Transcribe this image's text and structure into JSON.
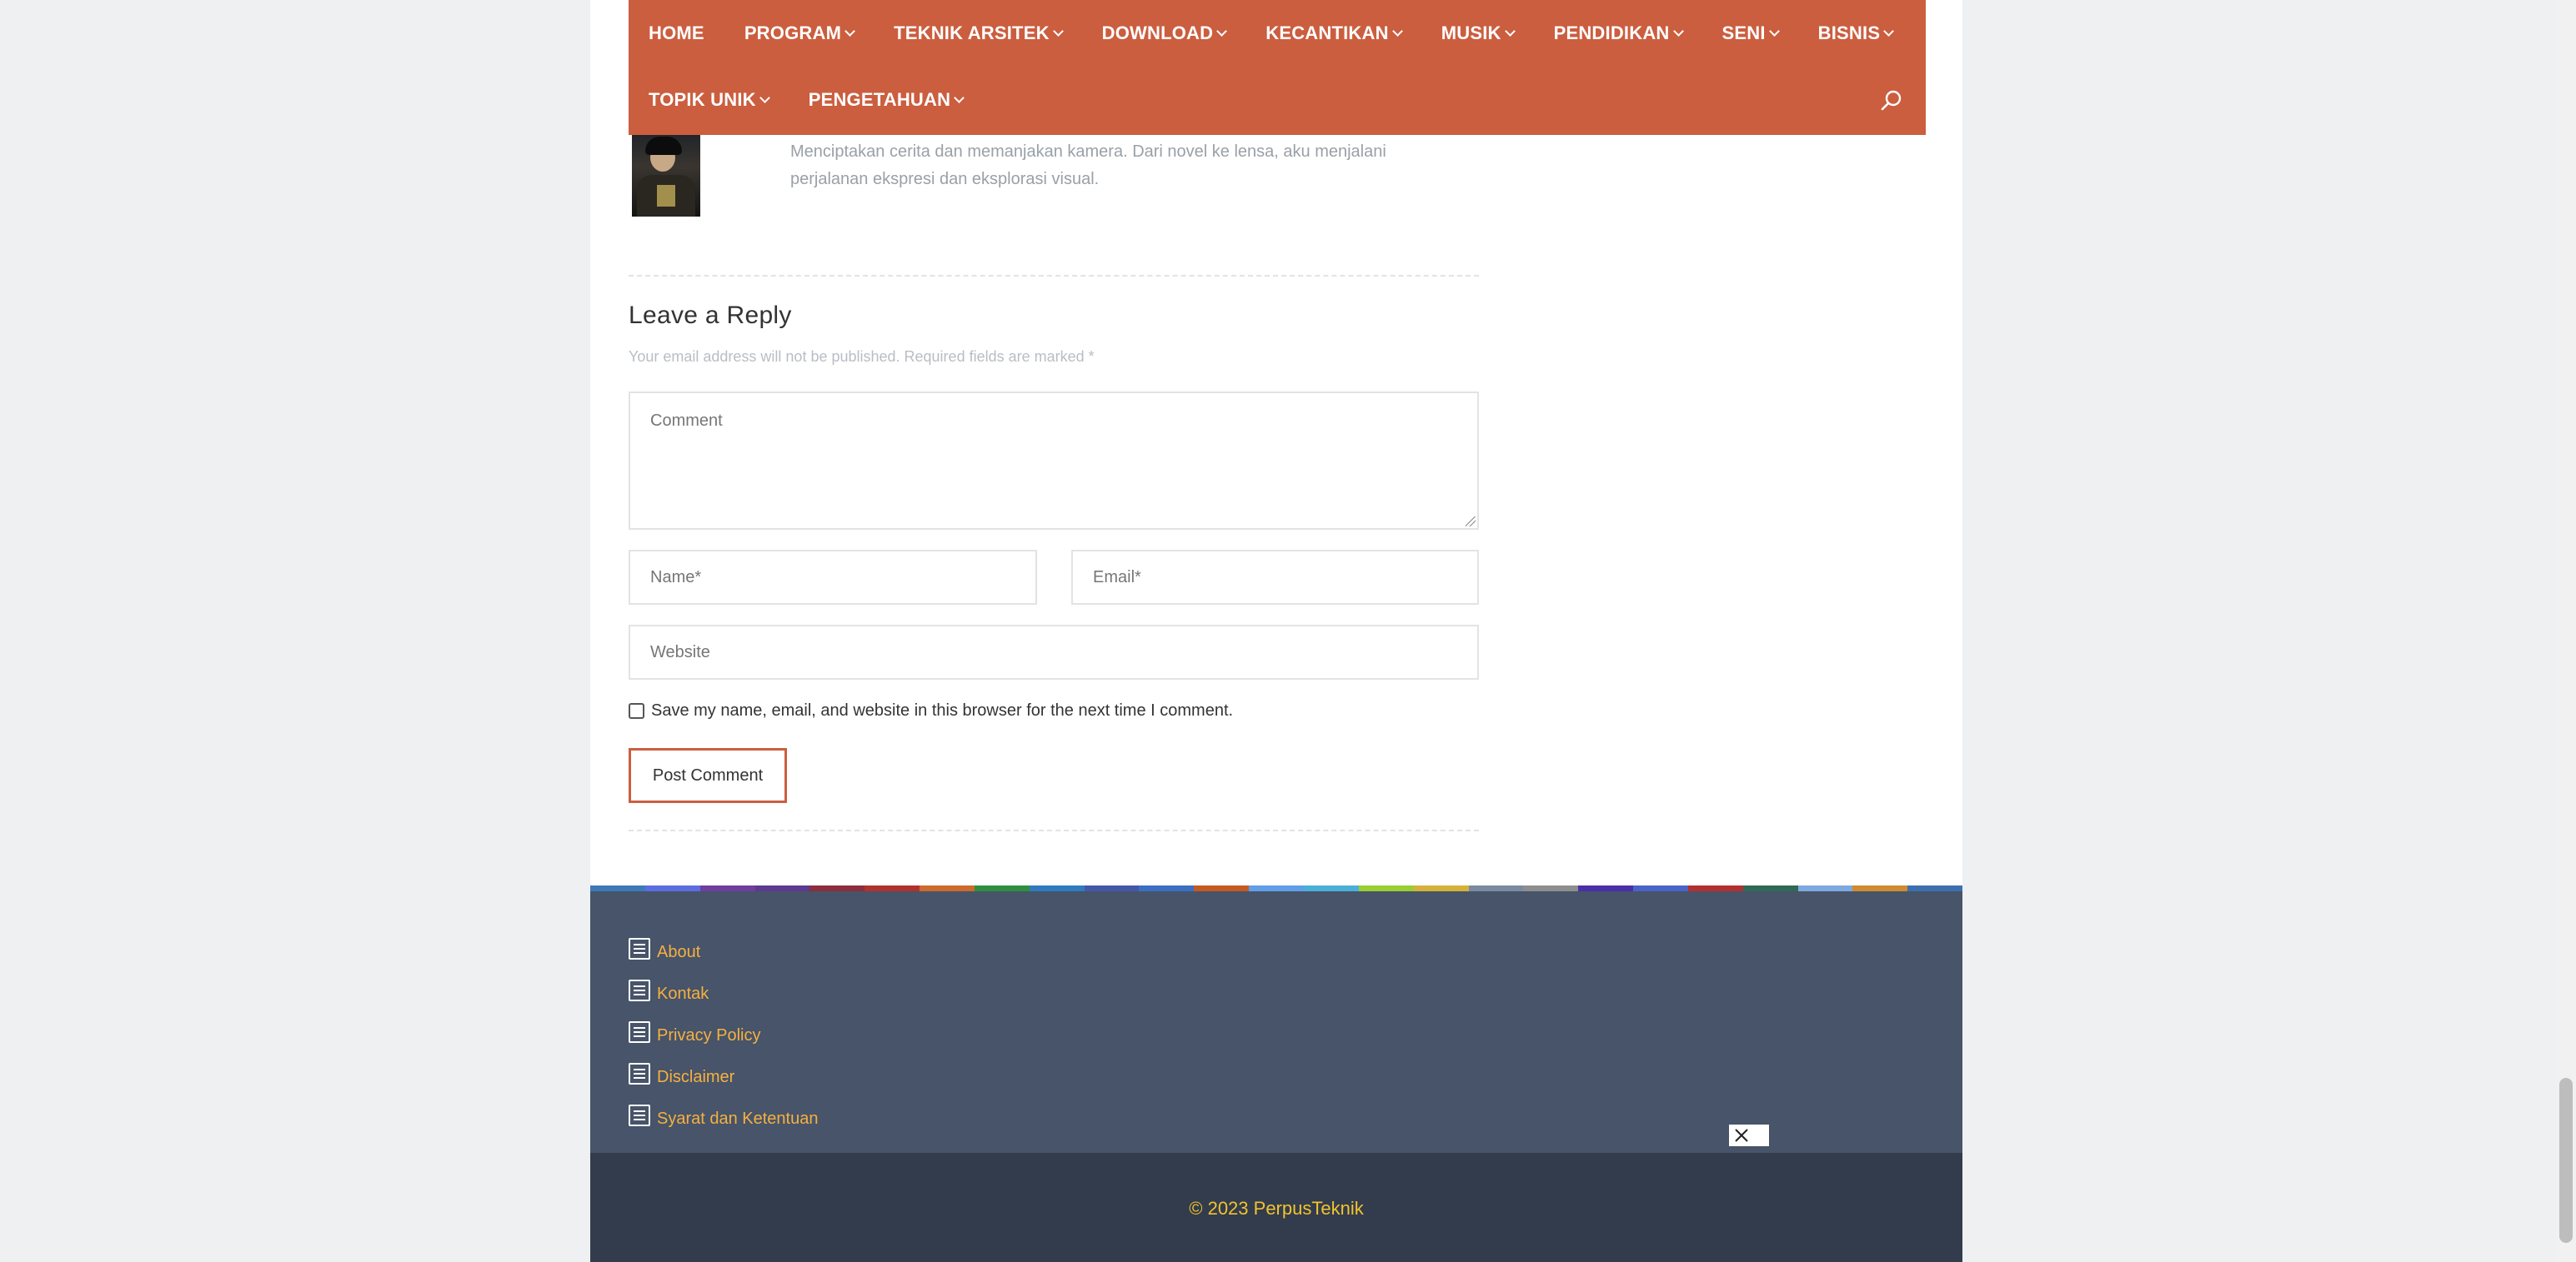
{
  "nav": {
    "row1": [
      {
        "label": "HOME",
        "has_dropdown": false
      },
      {
        "label": "PROGRAM",
        "has_dropdown": true
      },
      {
        "label": "TEKNIK ARSITEK",
        "has_dropdown": true
      },
      {
        "label": "DOWNLOAD",
        "has_dropdown": true
      },
      {
        "label": "KECANTIKAN",
        "has_dropdown": true
      },
      {
        "label": "MUSIK",
        "has_dropdown": true
      },
      {
        "label": "PENDIDIKAN",
        "has_dropdown": true
      },
      {
        "label": "SENI",
        "has_dropdown": true
      },
      {
        "label": "BISNIS",
        "has_dropdown": true
      }
    ],
    "row2": [
      {
        "label": "TOPIK UNIK",
        "has_dropdown": true
      },
      {
        "label": "PENGETAHUAN",
        "has_dropdown": true
      }
    ],
    "search_icon": "search-icon",
    "bg_color": "#cb5e3f"
  },
  "author": {
    "bio_line1": "Menciptakan cerita dan memanjakan kamera. Dari novel ke lensa, aku menjalani",
    "bio_line2": "perjalanan ekspresi dan eksplorasi visual."
  },
  "reply": {
    "title": "Leave a Reply",
    "notes": "Your email address will not be published. Required fields are marked *",
    "comment_placeholder": "Comment",
    "name_placeholder": "Name*",
    "email_placeholder": "Email*",
    "website_placeholder": "Website",
    "consent_label": "Save my name, email, and website in this browser for the next time I comment.",
    "consent_checked": false,
    "submit_label": "Post Comment",
    "accent_color": "#cb5e3f"
  },
  "footer": {
    "stripe_colors": [
      "#3d7ab8",
      "#5b6ee0",
      "#6f3e9e",
      "#5c3a8f",
      "#8b2e3e",
      "#b0322e",
      "#cc6b2c",
      "#2f8f3e",
      "#2e7bbf",
      "#4458a8",
      "#3a6fc2",
      "#c45a22",
      "#5f9ee8",
      "#4bb0d8",
      "#9acd32",
      "#d4b23a",
      "#7a8aa0",
      "#8e8e8e",
      "#4b2fa8",
      "#4a63c9",
      "#b23030",
      "#2f6a55",
      "#7ea9e0",
      "#cf8b2f",
      "#3d6fb0"
    ],
    "links": [
      {
        "label": "About",
        "icon": "document-icon"
      },
      {
        "label": "Kontak",
        "icon": "document-icon"
      },
      {
        "label": "Privacy Policy",
        "icon": "document-icon"
      },
      {
        "label": "Disclaimer",
        "icon": "document-icon"
      },
      {
        "label": "Syarat dan Ketentuan",
        "icon": "document-icon"
      }
    ],
    "copyright": "© 2023 PerpusTeknik",
    "link_color": "#f5b041",
    "top_bg": "#475469",
    "bottom_bg": "#323c4c"
  },
  "ad": {
    "close_icon": "close-icon"
  }
}
